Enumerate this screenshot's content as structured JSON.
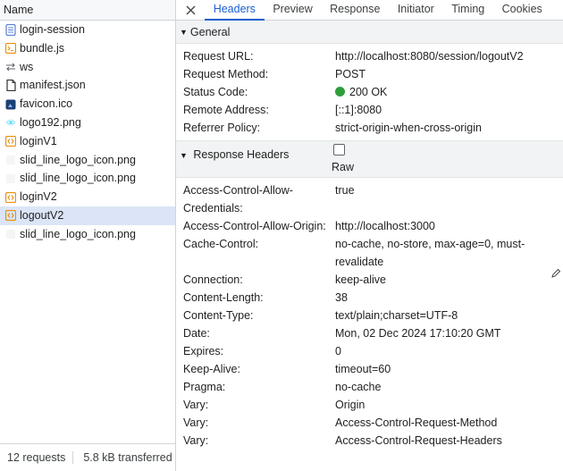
{
  "left_panel": {
    "header": "Name",
    "requests": [
      {
        "name": "login-session",
        "icon": "document-icon",
        "color": "#5b7fd6",
        "selected": false
      },
      {
        "name": "bundle.js",
        "icon": "script-file-icon",
        "color": "#e8900c",
        "selected": false
      },
      {
        "name": "ws",
        "icon": "websocket-arrows-icon",
        "color": "#5f6368",
        "selected": false
      },
      {
        "name": "manifest.json",
        "icon": "file-icon",
        "color": "#5f6368",
        "selected": false
      },
      {
        "name": "favicon.ico",
        "icon": "image-file-icon",
        "color": "#1a3f73",
        "selected": false
      },
      {
        "name": "logo192.png",
        "icon": "react-logo-icon",
        "color": "#61dafb",
        "selected": false
      },
      {
        "name": "loginV1",
        "icon": "fetch-icon",
        "color": "#e8900c",
        "selected": false
      },
      {
        "name": "slid_line_logo_icon.png",
        "icon": "blank-image-icon",
        "color": "#dddddd",
        "selected": false
      },
      {
        "name": "slid_line_logo_icon.png",
        "icon": "blank-image-icon",
        "color": "#dddddd",
        "selected": false
      },
      {
        "name": "loginV2",
        "icon": "fetch-icon",
        "color": "#e8900c",
        "selected": false
      },
      {
        "name": "logoutV2",
        "icon": "fetch-icon",
        "color": "#e8900c",
        "selected": true
      },
      {
        "name": "slid_line_logo_icon.png",
        "icon": "blank-image-icon",
        "color": "#dddddd",
        "selected": false
      }
    ],
    "footer": {
      "requests": "12 requests",
      "transferred": "5.8 kB transferred"
    }
  },
  "tabs": [
    {
      "label": "Headers",
      "active": true
    },
    {
      "label": "Preview",
      "active": false
    },
    {
      "label": "Response",
      "active": false
    },
    {
      "label": "Initiator",
      "active": false
    },
    {
      "label": "Timing",
      "active": false
    },
    {
      "label": "Cookies",
      "active": false
    }
  ],
  "general": {
    "title": "General",
    "rows": [
      {
        "key": "Request URL:",
        "value": "http://localhost:8080/session/logoutV2"
      },
      {
        "key": "Request Method:",
        "value": "POST"
      },
      {
        "key": "Status Code:",
        "value": "200 OK"
      },
      {
        "key": "Remote Address:",
        "value": "[::1]:8080"
      },
      {
        "key": "Referrer Policy:",
        "value": "strict-origin-when-cross-origin"
      }
    ]
  },
  "response_headers": {
    "title": "Response Headers",
    "raw_label": "Raw",
    "rows": [
      {
        "key": "Access-Control-Allow-Credentials:",
        "value": "true"
      },
      {
        "key": "Access-Control-Allow-Origin:",
        "value": "http://localhost:3000"
      },
      {
        "key": "Cache-Control:",
        "value": "no-cache, no-store, max-age=0, must-revalidate"
      },
      {
        "key": "Connection:",
        "value": "keep-alive"
      },
      {
        "key": "Content-Length:",
        "value": "38"
      },
      {
        "key": "Content-Type:",
        "value": "text/plain;charset=UTF-8"
      },
      {
        "key": "Date:",
        "value": "Mon, 02 Dec 2024 17:10:20 GMT"
      },
      {
        "key": "Expires:",
        "value": "0"
      },
      {
        "key": "Keep-Alive:",
        "value": "timeout=60"
      },
      {
        "key": "Pragma:",
        "value": "no-cache"
      },
      {
        "key": "Vary:",
        "value": "Origin"
      },
      {
        "key": "Vary:",
        "value": "Access-Control-Request-Method"
      },
      {
        "key": "Vary:",
        "value": "Access-Control-Request-Headers"
      }
    ]
  },
  "colors": {
    "accent": "#1a5fd1",
    "status_ok": "#2e9e3a",
    "selected_row": "#dbe5f7"
  }
}
